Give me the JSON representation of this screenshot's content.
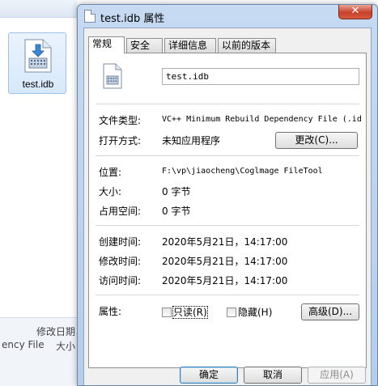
{
  "explorer": {
    "file_name": "test.idb",
    "detail_date_label": "修改日期",
    "detail_type": "ency File",
    "detail_size": "大小"
  },
  "dialog": {
    "title": "test.idb 属性",
    "close_glyph": "✕",
    "tabs": [
      "常规",
      "安全",
      "详细信息",
      "以前的版本"
    ],
    "file_name": "test.idb",
    "labels": {
      "file_type": "文件类型:",
      "opens_with": "打开方式:",
      "location": "位置:",
      "size": "大小:",
      "size_on_disk": "占用空间:",
      "created": "创建时间:",
      "modified": "修改时间:",
      "accessed": "访问时间:",
      "attributes": "属性:"
    },
    "values": {
      "file_type": "VC++ Minimum Rebuild Dependency File (.id",
      "opens_with": "未知应用程序",
      "location": "F:\\vp\\jiaocheng\\Coglmage FileTool",
      "size": "0 字节",
      "size_on_disk": "0 字节",
      "created": "2020年5月21日，14:17:00",
      "modified": "2020年5月21日，14:17:00",
      "accessed": "2020年5月21日，14:17:00"
    },
    "buttons": {
      "change": "更改(C)...",
      "advanced": "高级(D)...",
      "ok": "确定",
      "cancel": "取消",
      "apply": "应用(A)"
    },
    "attributes": {
      "readonly_label": "只读(R)",
      "readonly_checked": false,
      "hidden_label": "隐藏(H)",
      "hidden_checked": false
    }
  }
}
